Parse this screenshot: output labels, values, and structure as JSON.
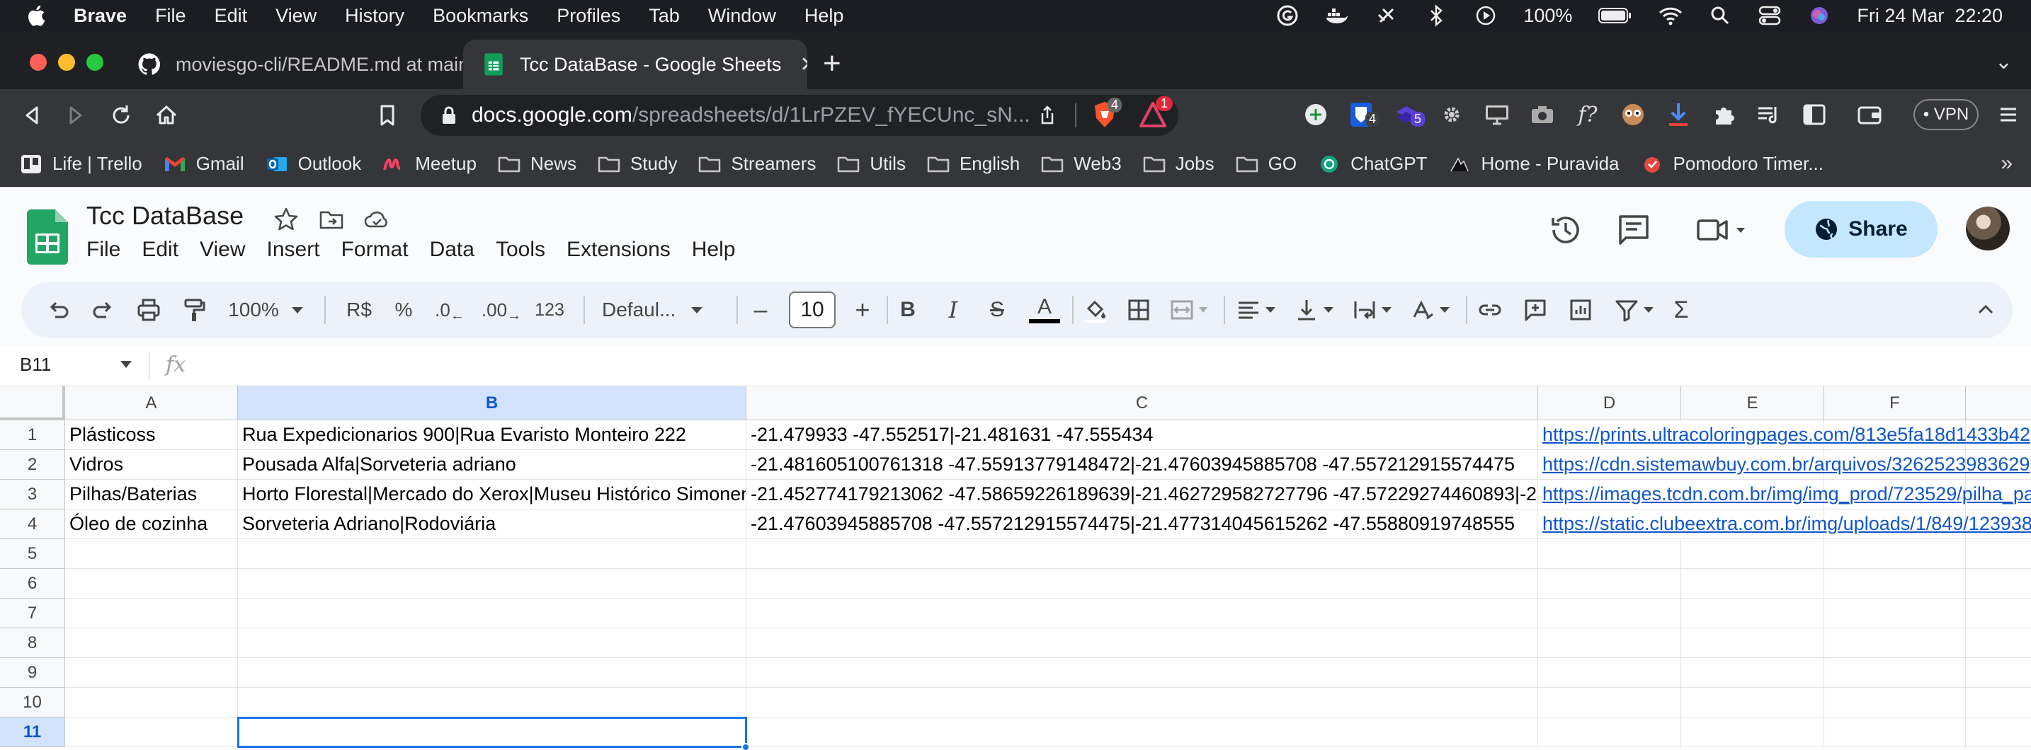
{
  "menubar": {
    "app": "Brave",
    "items": [
      "File",
      "Edit",
      "View",
      "History",
      "Bookmarks",
      "Profiles",
      "Tab",
      "Window",
      "Help"
    ],
    "battery": "100%",
    "datetime": "Fri 24 Mar  22:20"
  },
  "tabs": [
    {
      "title": "moviesgo-cli/README.md at main ·",
      "icon": "github-icon"
    },
    {
      "title": "Tcc DataBase - Google Sheets",
      "icon": "sheets-icon",
      "active": true
    }
  ],
  "address": {
    "host": "docs.google.com",
    "path": "/spreadsheets/d/1LrPZEV_fYECUnc_sN...",
    "brave_badge": "4",
    "alert_badge": "1",
    "ext_badge_1": "4",
    "ext_badge_2": "5",
    "vpn": "• VPN"
  },
  "bookmarks": [
    {
      "label": "Life | Trello",
      "icon": "trello-icon"
    },
    {
      "label": "Gmail",
      "icon": "gmail-icon"
    },
    {
      "label": "Outlook",
      "icon": "outlook-icon"
    },
    {
      "label": "Meetup",
      "icon": "meetup-icon"
    },
    {
      "label": "News",
      "icon": "folder-icon"
    },
    {
      "label": "Study",
      "icon": "folder-icon"
    },
    {
      "label": "Streamers",
      "icon": "folder-icon"
    },
    {
      "label": "Utils",
      "icon": "folder-icon"
    },
    {
      "label": "English",
      "icon": "folder-icon"
    },
    {
      "label": "Web3",
      "icon": "folder-icon"
    },
    {
      "label": "Jobs",
      "icon": "folder-icon"
    },
    {
      "label": "GO",
      "icon": "folder-icon"
    },
    {
      "label": "ChatGPT",
      "icon": "chatgpt-icon"
    },
    {
      "label": "Home - Puravida",
      "icon": "puravida-icon"
    },
    {
      "label": "Pomodoro Timer...",
      "icon": "pomodoro-icon"
    }
  ],
  "sheet": {
    "title": "Tcc DataBase",
    "menus": [
      "File",
      "Edit",
      "View",
      "Insert",
      "Format",
      "Data",
      "Tools",
      "Extensions",
      "Help"
    ],
    "share_label": "Share"
  },
  "toolbar": {
    "zoom": "100%",
    "currency": "R$",
    "percent": "%",
    "dec_decrease": ".0",
    "dec_increase": ".00",
    "number_format": "123",
    "font": "Defaul...",
    "font_size": "10"
  },
  "formula": {
    "namebox": "B11",
    "fx": "fx"
  },
  "columns": [
    "A",
    "B",
    "C",
    "D",
    "E",
    "F"
  ],
  "rows": [
    "1",
    "2",
    "3",
    "4",
    "5",
    "6",
    "7",
    "8",
    "9",
    "10",
    "11"
  ],
  "cells": [
    [
      "Plásticoss",
      "Rua Expedicionarios 900|Rua Evaristo Monteiro 222",
      "-21.479933 -47.552517|-21.481631 -47.555434",
      "https://prints.ultracoloringpages.com/813e5fa18d1433b42"
    ],
    [
      "Vidros",
      "Pousada Alfa|Sorveteria adriano",
      "-21.481605100761318 -47.55913779148472|-21.47603945885708 -47.557212915574475",
      "https://cdn.sistemawbuy.com.br/arquivos/3262523983629"
    ],
    [
      "Pilhas/Baterias",
      "Horto Florestal|Mercado do Xerox|Museu Histórico Simonen",
      "-21.452774179213062 -47.58659226189639|-21.462729582727796 -47.57229274460893|-21",
      "https://images.tcdn.com.br/img/img_prod/723529/pilha_pa"
    ],
    [
      "Óleo de cozinha",
      "Sorveteria Adriano|Rodoviária",
      "-21.47603945885708 -47.557212915574475|-21.477314045615262 -47.55880919748555",
      "https://static.clubeextra.com.br/img/uploads/1/849/123938"
    ]
  ]
}
